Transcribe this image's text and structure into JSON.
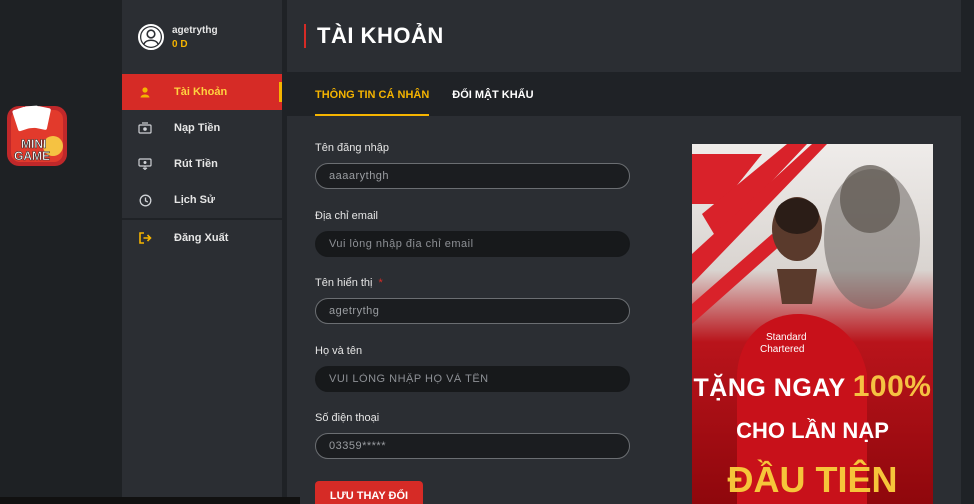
{
  "logo": {
    "line1": "MINI",
    "line2": "GAME"
  },
  "user": {
    "name": "agetrythg",
    "balance": "0 D"
  },
  "menu": [
    {
      "label": "Tài Khoản",
      "icon": "user-icon",
      "active": true
    },
    {
      "label": "Nạp Tiền",
      "icon": "deposit-icon",
      "active": false
    },
    {
      "label": "Rút Tiền",
      "icon": "withdraw-icon",
      "active": false
    },
    {
      "label": "Lịch Sử",
      "icon": "history-icon",
      "active": false
    },
    {
      "label": "Đăng Xuất",
      "icon": "logout-icon",
      "active": false
    }
  ],
  "page": {
    "title": "TÀI KHOẢN"
  },
  "tabs": [
    {
      "label": "THÔNG TIN CÁ NHÂN",
      "active": true
    },
    {
      "label": "ĐỔI MẬT KHẨU",
      "active": false
    }
  ],
  "form": {
    "username": {
      "label": "Tên đăng nhập",
      "value": "aaaarythgh"
    },
    "email": {
      "label": "Địa chỉ email",
      "placeholder": "Vui lòng nhập địa chỉ email",
      "value": ""
    },
    "display_name": {
      "label": "Tên hiển thị",
      "required_mark": "*",
      "value": "agetrythg"
    },
    "full_name": {
      "label": "Họ và tên",
      "placeholder": "VUI LÒNG NHẬP HỌ VÀ TÊN",
      "value": ""
    },
    "phone": {
      "label": "Số điện thoại",
      "value": "03359*****"
    },
    "save_label": "LƯU THAY ĐỔI"
  },
  "banner": {
    "line1_prefix": "TẶNG NGAY",
    "line1_highlight": "100%",
    "line2": "CHO LẦN NẠP",
    "line3": "ĐẦU TIÊN",
    "sponsor_line1": "Standard",
    "sponsor_line2": "Chartered"
  },
  "colors": {
    "accent_red": "#d62b26",
    "accent_gold": "#f5b400",
    "background": "#1f2226",
    "panel": "#2b2e33"
  }
}
